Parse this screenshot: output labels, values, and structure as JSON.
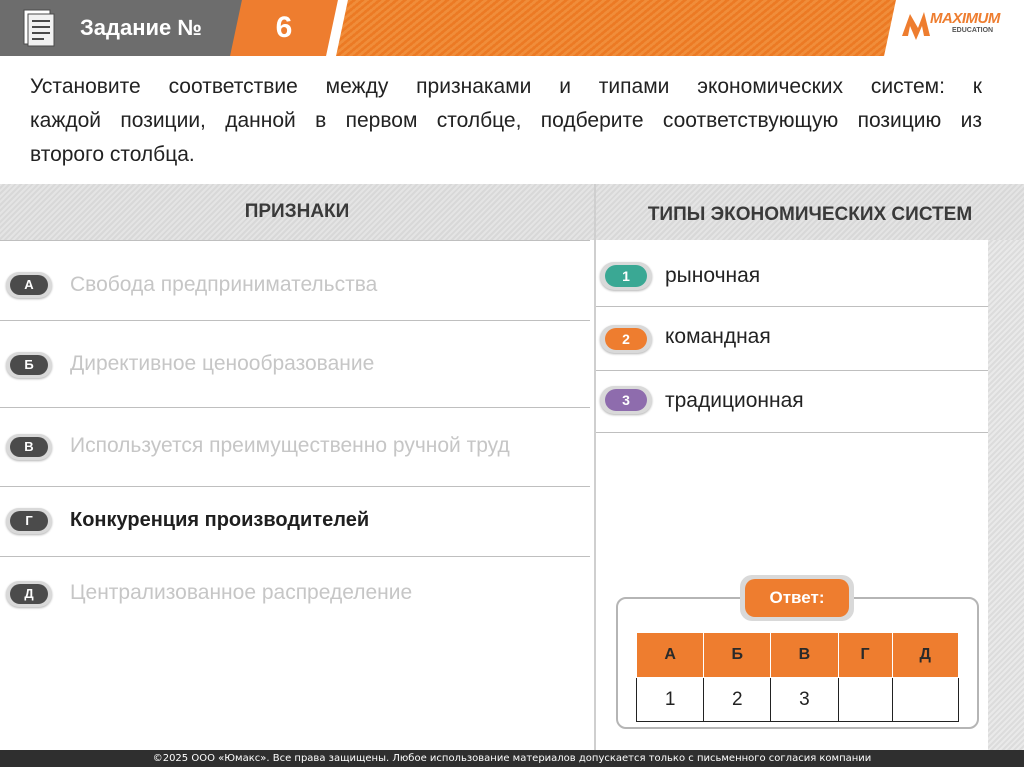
{
  "header": {
    "title": "Задание №",
    "task_number": "6",
    "logo_text": "MAXIMUM",
    "logo_sub": "EDUCATION",
    "accent_color": "#ee7d2f"
  },
  "instruction": {
    "lines": [
      "Установите соответствие между признаками и типами экономических систем: к",
      "каждой позиции, данной в первом столбце, подберите соответствующую позицию из",
      "второго столбца."
    ]
  },
  "columns": {
    "left_title": "ПРИЗНАКИ",
    "right_title": "ТИПЫ ЭКОНОМИЧЕСКИХ СИСТЕМ"
  },
  "features": [
    {
      "letter": "А",
      "text": "Свобода предпринимательства",
      "state": "faded"
    },
    {
      "letter": "Б",
      "text": "Директивное ценообразование",
      "state": "faded"
    },
    {
      "letter": "В",
      "text": "Используется преимущественно ручной труд",
      "state": "faded"
    },
    {
      "letter": "Г",
      "text": "Конкуренция производителей",
      "state": "active"
    },
    {
      "letter": "Д",
      "text": "Централизованное распределение",
      "state": "faded"
    }
  ],
  "types": [
    {
      "number": "1",
      "text": "рыночная",
      "color": "#3aa894"
    },
    {
      "number": "2",
      "text": "командная",
      "color": "#ee7d2f"
    },
    {
      "number": "3",
      "text": "традиционная",
      "color": "#8e6cad"
    }
  ],
  "answer": {
    "label": "Ответ:",
    "headers": [
      "А",
      "Б",
      "В",
      "Г",
      "Д"
    ],
    "values": [
      "1",
      "2",
      "3",
      "",
      ""
    ]
  },
  "footer": {
    "text": "©2025 ООО «Юмакс». Все права защищены. Любое использование материалов допускается только с письменного согласия компании"
  }
}
